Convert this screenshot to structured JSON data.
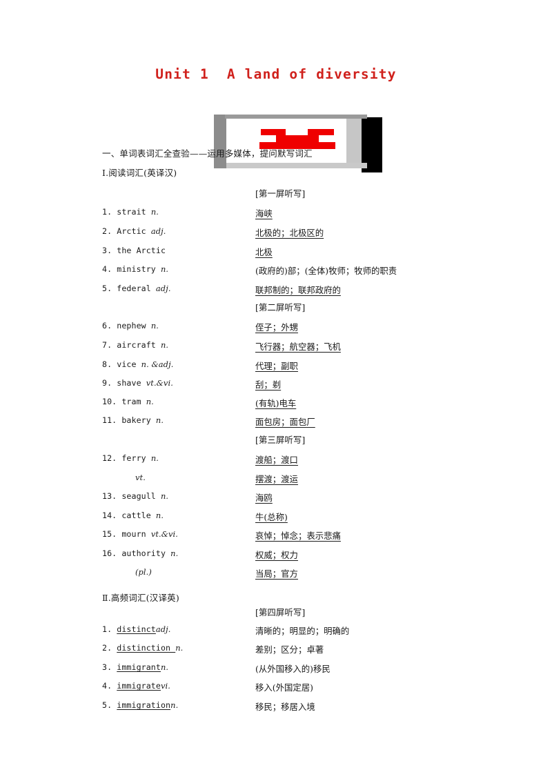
{
  "title": "Unit 1  A land of diversity",
  "accent_color": "#d0211c",
  "graphic": {
    "name": "media-decoration",
    "red_color": "#ef0000",
    "frame_dark": "#000000",
    "frame_gray": "#8c8c8c"
  },
  "headings": {
    "main": "一、单词表词汇全查验——运用多媒体，提问默写词汇",
    "part_1": "Ⅰ.阅读词汇(英译汉)",
    "part_2": "Ⅱ.高频词汇(汉译英)"
  },
  "screen_labels": {
    "screen_1": "[第一屏听写]",
    "screen_2": "[第二屏听写]",
    "screen_3": "[第三屏听写]",
    "screen_4": "[第四屏听写]"
  },
  "part_1_items": [
    {
      "num": "1.",
      "word": "strait",
      "pos": "n.",
      "meaning": "海峡",
      "underline_word": false,
      "underline_meaning": true,
      "indent": false
    },
    {
      "num": "2.",
      "word": "Arctic",
      "pos": "adj.",
      "meaning": "北极的；北极区的",
      "underline_word": false,
      "underline_meaning": true,
      "indent": false
    },
    {
      "num": "3.",
      "word": "the Arctic",
      "pos": "",
      "meaning": "北极",
      "underline_word": false,
      "underline_meaning": true,
      "indent": false
    },
    {
      "num": "4.",
      "word": "ministry",
      "pos": "n.",
      "meaning": "(政府的)部；(全体)牧师；牧师的职责",
      "underline_word": false,
      "underline_meaning": false,
      "indent": false
    },
    {
      "num": "5.",
      "word": "federal",
      "pos": "adj.",
      "meaning": "联邦制的；联邦政府的",
      "underline_word": false,
      "underline_meaning": true,
      "indent": false
    },
    {
      "num": "6.",
      "word": "nephew",
      "pos": "n.",
      "meaning": "侄子；外甥",
      "underline_word": false,
      "underline_meaning": true,
      "indent": false
    },
    {
      "num": "7.",
      "word": "aircraft",
      "pos": "n.",
      "meaning": "飞行器；航空器；飞机",
      "underline_word": false,
      "underline_meaning": true,
      "indent": false
    },
    {
      "num": "8.",
      "word": "vice",
      "pos": "n. &adj.",
      "meaning": "代理；副职",
      "underline_word": false,
      "underline_meaning": true,
      "indent": false
    },
    {
      "num": "9.",
      "word": "shave",
      "pos": "vt.&vi.",
      "meaning": "刮；剃",
      "underline_word": false,
      "underline_meaning": true,
      "indent": false
    },
    {
      "num": "10.",
      "word": "tram",
      "pos": "n.",
      "meaning": "(有轨)电车",
      "underline_word": false,
      "underline_meaning": true,
      "indent": false
    },
    {
      "num": "11.",
      "word": "bakery",
      "pos": "n.",
      "meaning": "面包房；面包厂",
      "underline_word": false,
      "underline_meaning": true,
      "indent": false
    },
    {
      "num": "12.",
      "word": "ferry",
      "pos": "n.",
      "meaning": "渡船；渡口",
      "underline_word": false,
      "underline_meaning": true,
      "indent": false
    },
    {
      "num": "",
      "word": "",
      "pos": "vt.",
      "meaning": "摆渡；渡运",
      "underline_word": false,
      "underline_meaning": true,
      "indent": true
    },
    {
      "num": "13.",
      "word": "seagull",
      "pos": "n.",
      "meaning": "海鸥",
      "underline_word": false,
      "underline_meaning": true,
      "indent": false
    },
    {
      "num": "14.",
      "word": "cattle",
      "pos": "n.",
      "meaning": "牛(总称)",
      "underline_word": false,
      "underline_meaning": true,
      "indent": false
    },
    {
      "num": "15.",
      "word": "mourn",
      "pos": "vt.&vi.",
      "meaning": "哀悼；悼念；表示悲痛",
      "underline_word": false,
      "underline_meaning": true,
      "indent": false
    },
    {
      "num": "16.",
      "word": "authority",
      "pos": "n.",
      "meaning": "权威；权力",
      "underline_word": false,
      "underline_meaning": true,
      "indent": false
    },
    {
      "num": "",
      "word": "",
      "pos": "(pl.)",
      "meaning": "当局；官方",
      "underline_word": false,
      "underline_meaning": true,
      "indent": true
    }
  ],
  "part_2_items": [
    {
      "num": "1.",
      "word": "distinct",
      "pos": "adj.",
      "meaning": "清晰的；明显的；明确的",
      "underline_word": true,
      "underline_meaning": false,
      "indent": false
    },
    {
      "num": "2.",
      "word": "distinction ",
      "pos": "n.",
      "meaning": "差别；区分；卓著",
      "underline_word": true,
      "underline_meaning": false,
      "indent": false
    },
    {
      "num": "3.",
      "word": "immigrant",
      "pos": "n.",
      "meaning": "(从外国移入的)移民",
      "underline_word": true,
      "underline_meaning": false,
      "indent": false
    },
    {
      "num": "4.",
      "word": "immigrate",
      "pos": "vi.",
      "meaning": "移入(外国定居)",
      "underline_word": true,
      "underline_meaning": false,
      "indent": false
    },
    {
      "num": "5.",
      "word": "immigration",
      "pos": "n.",
      "meaning": "移民；移居入境",
      "underline_word": true,
      "underline_meaning": false,
      "indent": false
    }
  ]
}
